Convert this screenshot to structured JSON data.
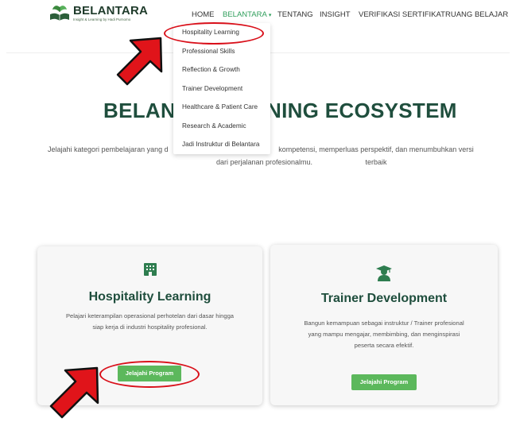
{
  "header": {
    "logo_name": "BELANTARA",
    "logo_tagline": "Insight & Learning by Hadi Purnomo",
    "nav": [
      "HOME",
      "BELANTARA",
      "TENTANG",
      "INSIGHT",
      "VERIFIKASI SERTIFIKAT",
      "RUANG BELAJAR"
    ],
    "active_caret": "▾"
  },
  "dropdown": {
    "items": [
      "Hospitality Learning",
      "Professional Skills",
      "Reflection & Growth",
      "Trainer Development",
      "Healthcare & Patient Care",
      "Research & Academic",
      "Jadi Instruktur di Belantara"
    ]
  },
  "hero": {
    "title_left": "BELANT",
    "title_right": "NING ECOSYSTEM",
    "subtitle_line1_left": "Jelajahi kategori pembelajaran yang d",
    "subtitle_line1_right": "kompetensi, memperluas perspektif, dan menumbuhkan versi terbaik",
    "subtitle_line2": "dari perjalanan profesionalmu."
  },
  "cards": [
    {
      "icon": "building-icon",
      "title": "Hospitality Learning",
      "desc_lines": [
        "Pelajari keterampilan operasional perhotelan dari dasar hingga",
        "siap kerja di industri hospitality profesional."
      ],
      "button": "Jelajahi Program"
    },
    {
      "icon": "graduate-icon",
      "title": "Trainer Development",
      "desc_lines": [
        "Bangun kemampuan sebagai instruktur / Trainer profesional",
        "yang mampu mengajar, membimbing, dan menginspirasi",
        "peserta secara efektif."
      ],
      "button": "Jelajahi Program"
    }
  ],
  "colors": {
    "brand_green": "#1f4e3d",
    "button_green": "#5cb85c",
    "annotation_red": "#d9101a",
    "nav_active": "#2f9e5b"
  }
}
